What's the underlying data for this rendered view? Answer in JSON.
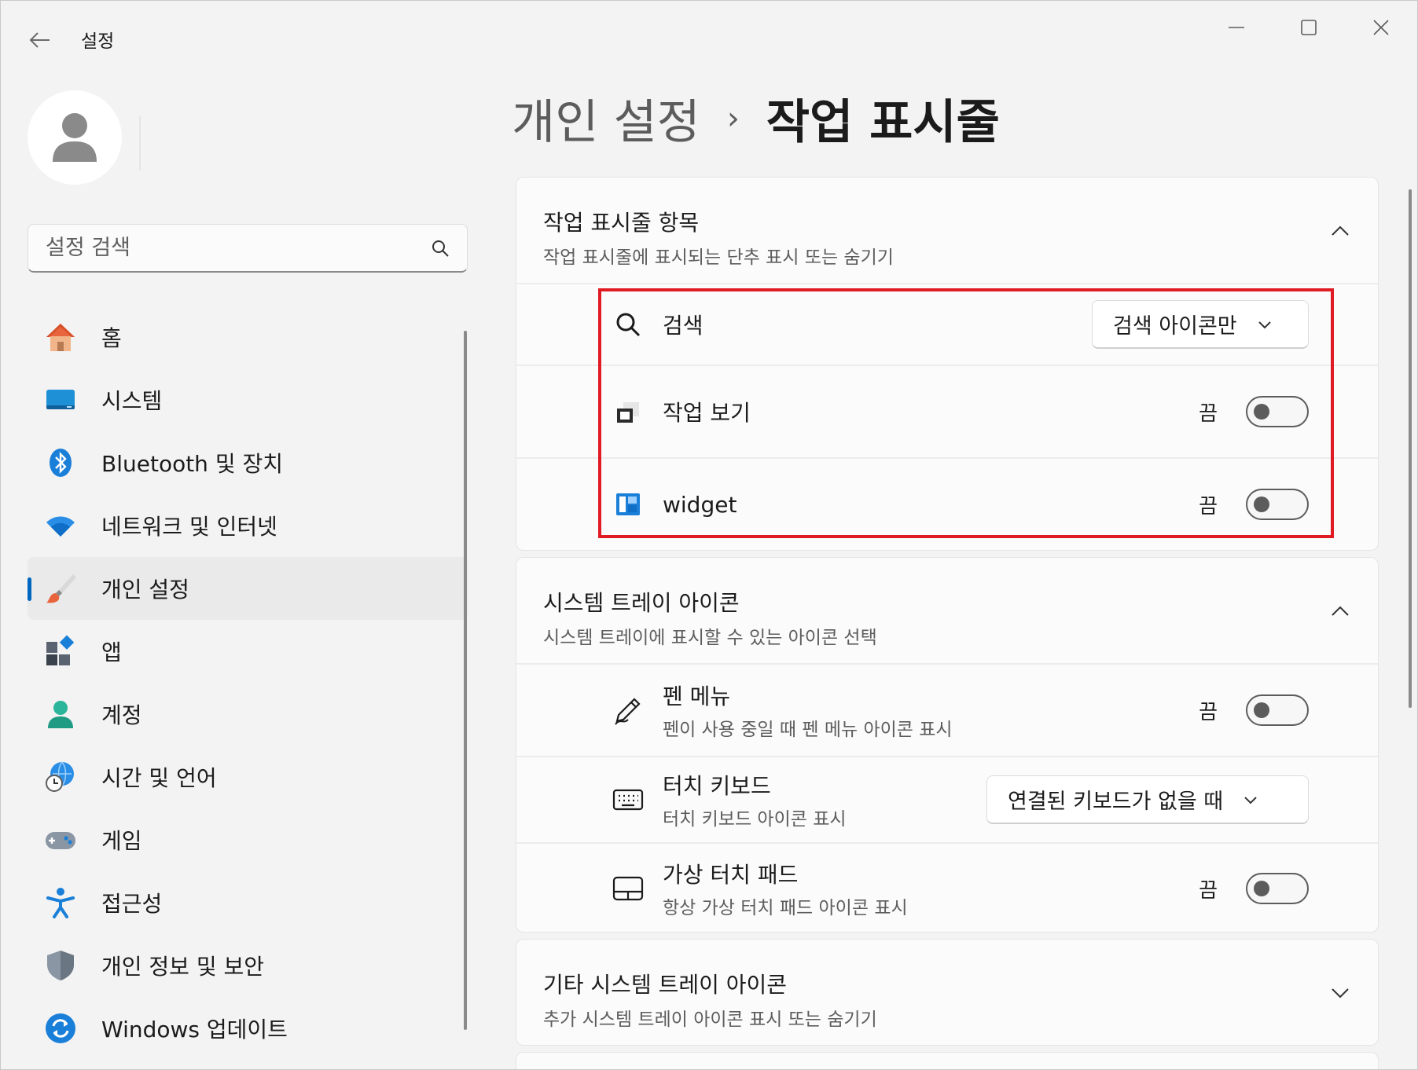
{
  "window": {
    "title": "설정",
    "controls": [
      "minimize",
      "maximize",
      "close"
    ]
  },
  "sidebar": {
    "search_placeholder": "설정 검색",
    "items": [
      {
        "label": "홈",
        "icon": "home-icon"
      },
      {
        "label": "시스템",
        "icon": "system-display-icon"
      },
      {
        "label": "Bluetooth 및 장치",
        "icon": "bluetooth-icon"
      },
      {
        "label": "네트워크 및 인터넷",
        "icon": "wifi-icon"
      },
      {
        "label": "개인 설정",
        "icon": "paintbrush-icon",
        "active": true
      },
      {
        "label": "앱",
        "icon": "apps-icon"
      },
      {
        "label": "계정",
        "icon": "account-icon"
      },
      {
        "label": "시간 및 언어",
        "icon": "time-language-icon"
      },
      {
        "label": "게임",
        "icon": "gamepad-icon"
      },
      {
        "label": "접근성",
        "icon": "accessibility-icon"
      },
      {
        "label": "개인 정보 및 보안",
        "icon": "shield-icon"
      },
      {
        "label": "Windows 업데이트",
        "icon": "windows-update-icon"
      }
    ]
  },
  "breadcrumb": {
    "parent": "개인 설정",
    "separator": "›",
    "current": "작업 표시줄"
  },
  "taskbar_items": {
    "title": "작업 표시줄 항목",
    "subtitle": "작업 표시줄에 표시되는 단추 표시 또는 숨기기",
    "expanded": true,
    "rows": [
      {
        "label": "검색",
        "icon": "search-icon",
        "control": "dropdown",
        "value": "검색 아이콘만"
      },
      {
        "label": "작업 보기",
        "icon": "task-view-icon",
        "control": "toggle",
        "state": "끔",
        "on": false
      },
      {
        "label": "widget",
        "icon": "widgets-icon",
        "control": "toggle",
        "state": "끔",
        "on": false
      }
    ]
  },
  "system_tray": {
    "title": "시스템 트레이 아이콘",
    "subtitle": "시스템 트레이에 표시할 수 있는 아이콘 선택",
    "expanded": true,
    "rows": [
      {
        "label": "펜 메뉴",
        "sub": "펜이 사용 중일 때 펜 메뉴 아이콘 표시",
        "icon": "pen-icon",
        "control": "toggle",
        "state": "끔",
        "on": false
      },
      {
        "label": "터치 키보드",
        "sub": "터치 키보드 아이콘 표시",
        "icon": "keyboard-icon",
        "control": "dropdown",
        "value": "연결된 키보드가 없을 때"
      },
      {
        "label": "가상 터치 패드",
        "sub": "항상 가상 터치 패드 아이콘 표시",
        "icon": "touchpad-icon",
        "control": "toggle",
        "state": "끔",
        "on": false
      }
    ]
  },
  "other_tray": {
    "title": "기타 시스템 트레이 아이콘",
    "subtitle": "추가 시스템 트레이 아이콘 표시 또는 숨기기",
    "expanded": false
  },
  "colors": {
    "accent": "#0067c0",
    "highlight": "#e01b24",
    "background": "#f3f3f3",
    "card": "#fbfbfb"
  }
}
